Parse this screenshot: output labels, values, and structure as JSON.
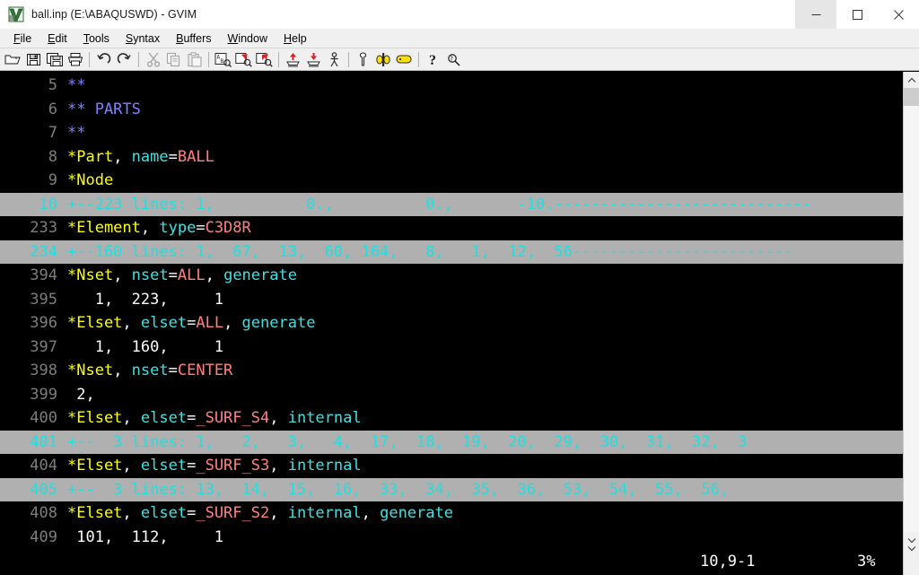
{
  "window": {
    "title": "ball.inp (E:\\ABAQUSWD) - GVIM",
    "app_icon": "gvim-icon",
    "controls": {
      "minimize": "–",
      "maximize": "□",
      "close": "✕"
    }
  },
  "menubar": {
    "items": [
      {
        "label": "File",
        "accel": "F"
      },
      {
        "label": "Edit",
        "accel": "E"
      },
      {
        "label": "Tools",
        "accel": "T"
      },
      {
        "label": "Syntax",
        "accel": "S"
      },
      {
        "label": "Buffers",
        "accel": "B"
      },
      {
        "label": "Window",
        "accel": "W"
      },
      {
        "label": "Help",
        "accel": "H"
      }
    ]
  },
  "toolbar": {
    "buttons": [
      {
        "name": "open-file-icon",
        "tip": "Open file"
      },
      {
        "name": "save-file-icon",
        "tip": "Save current file"
      },
      {
        "name": "save-all-icon",
        "tip": "Save all files"
      },
      {
        "name": "print-icon",
        "tip": "Print"
      },
      {
        "separator": true
      },
      {
        "name": "undo-icon",
        "tip": "Undo"
      },
      {
        "name": "redo-icon",
        "tip": "Redo"
      },
      {
        "separator": true
      },
      {
        "name": "cut-icon",
        "tip": "Cut",
        "disabled": true
      },
      {
        "name": "copy-icon",
        "tip": "Copy",
        "disabled": true
      },
      {
        "name": "paste-icon",
        "tip": "Paste",
        "disabled": true
      },
      {
        "separator": true
      },
      {
        "name": "find-replace-icon",
        "tip": "Find and replace"
      },
      {
        "name": "find-next-icon",
        "tip": "Find next"
      },
      {
        "name": "find-previous-icon",
        "tip": "Find previous"
      },
      {
        "separator": true
      },
      {
        "name": "load-session-icon",
        "tip": "Load session"
      },
      {
        "name": "save-session-icon",
        "tip": "Save session"
      },
      {
        "name": "run-script-icon",
        "tip": "Run a script"
      },
      {
        "separator": true
      },
      {
        "name": "make-icon",
        "tip": "Make current project"
      },
      {
        "name": "shell-icon",
        "tip": "Open a command shell"
      },
      {
        "name": "make-tags-icon",
        "tip": "Make tags"
      },
      {
        "separator": true
      },
      {
        "name": "help-icon",
        "tip": "Help"
      },
      {
        "name": "find-help-icon",
        "tip": "Search help"
      }
    ]
  },
  "editor": {
    "lines": [
      {
        "num": "5",
        "fold": false,
        "tokens": [
          {
            "t": "**",
            "c": "c-comment"
          }
        ]
      },
      {
        "num": "6",
        "fold": false,
        "tokens": [
          {
            "t": "** PARTS",
            "c": "c-comment"
          }
        ]
      },
      {
        "num": "7",
        "fold": false,
        "tokens": [
          {
            "t": "**",
            "c": "c-comment"
          }
        ]
      },
      {
        "num": "8",
        "fold": false,
        "tokens": [
          {
            "t": "*Part",
            "c": "c-keyword"
          },
          {
            "t": ", ",
            "c": "c-punct"
          },
          {
            "t": "name",
            "c": "c-param"
          },
          {
            "t": "=",
            "c": "c-punct"
          },
          {
            "t": "BALL",
            "c": "c-value"
          }
        ]
      },
      {
        "num": "9",
        "fold": false,
        "tokens": [
          {
            "t": "*Node",
            "c": "c-keyword"
          }
        ]
      },
      {
        "num": "10",
        "fold": true,
        "text": "+--223 lines: 1,          0.,          0.,       -10.----------------------------"
      },
      {
        "num": "233",
        "fold": false,
        "tokens": [
          {
            "t": "*Element",
            "c": "c-keyword"
          },
          {
            "t": ", ",
            "c": "c-punct"
          },
          {
            "t": "type",
            "c": "c-param"
          },
          {
            "t": "=",
            "c": "c-punct"
          },
          {
            "t": "C3D8R",
            "c": "c-value"
          }
        ]
      },
      {
        "num": "234",
        "fold": true,
        "text": "+--160 lines: 1,  67,  13,  60, 164,   8,   1,  12,  56------------------------"
      },
      {
        "num": "394",
        "fold": false,
        "tokens": [
          {
            "t": "*Nset",
            "c": "c-keyword"
          },
          {
            "t": ", ",
            "c": "c-punct"
          },
          {
            "t": "nset",
            "c": "c-param"
          },
          {
            "t": "=",
            "c": "c-punct"
          },
          {
            "t": "ALL",
            "c": "c-value"
          },
          {
            "t": ", ",
            "c": "c-punct"
          },
          {
            "t": "generate",
            "c": "c-param"
          }
        ]
      },
      {
        "num": "395",
        "fold": false,
        "tokens": [
          {
            "t": "   1,  223,     1",
            "c": "c-plain"
          }
        ]
      },
      {
        "num": "396",
        "fold": false,
        "tokens": [
          {
            "t": "*Elset",
            "c": "c-keyword"
          },
          {
            "t": ", ",
            "c": "c-punct"
          },
          {
            "t": "elset",
            "c": "c-param"
          },
          {
            "t": "=",
            "c": "c-punct"
          },
          {
            "t": "ALL",
            "c": "c-value"
          },
          {
            "t": ", ",
            "c": "c-punct"
          },
          {
            "t": "generate",
            "c": "c-param"
          }
        ]
      },
      {
        "num": "397",
        "fold": false,
        "tokens": [
          {
            "t": "   1,  160,     1",
            "c": "c-plain"
          }
        ]
      },
      {
        "num": "398",
        "fold": false,
        "tokens": [
          {
            "t": "*Nset",
            "c": "c-keyword"
          },
          {
            "t": ", ",
            "c": "c-punct"
          },
          {
            "t": "nset",
            "c": "c-param"
          },
          {
            "t": "=",
            "c": "c-punct"
          },
          {
            "t": "CENTER",
            "c": "c-value"
          }
        ]
      },
      {
        "num": "399",
        "fold": false,
        "tokens": [
          {
            "t": " 2,",
            "c": "c-plain"
          }
        ]
      },
      {
        "num": "400",
        "fold": false,
        "tokens": [
          {
            "t": "*Elset",
            "c": "c-keyword"
          },
          {
            "t": ", ",
            "c": "c-punct"
          },
          {
            "t": "elset",
            "c": "c-param"
          },
          {
            "t": "=",
            "c": "c-punct"
          },
          {
            "t": "_SURF_S4",
            "c": "c-value"
          },
          {
            "t": ", ",
            "c": "c-punct"
          },
          {
            "t": "internal",
            "c": "c-param"
          }
        ]
      },
      {
        "num": "401",
        "fold": true,
        "text": "+--  3 lines: 1,   2,   3,   4,  17,  18,  19,  20,  29,  30,  31,  32,  3"
      },
      {
        "num": "404",
        "fold": false,
        "tokens": [
          {
            "t": "*Elset",
            "c": "c-keyword"
          },
          {
            "t": ", ",
            "c": "c-punct"
          },
          {
            "t": "elset",
            "c": "c-param"
          },
          {
            "t": "=",
            "c": "c-punct"
          },
          {
            "t": "_SURF_S3",
            "c": "c-value"
          },
          {
            "t": ", ",
            "c": "c-punct"
          },
          {
            "t": "internal",
            "c": "c-param"
          }
        ]
      },
      {
        "num": "405",
        "fold": true,
        "text": "+--  3 lines: 13,  14,  15,  16,  33,  34,  35,  36,  53,  54,  55,  56,"
      },
      {
        "num": "408",
        "fold": false,
        "tokens": [
          {
            "t": "*Elset",
            "c": "c-keyword"
          },
          {
            "t": ", ",
            "c": "c-punct"
          },
          {
            "t": "elset",
            "c": "c-param"
          },
          {
            "t": "=",
            "c": "c-punct"
          },
          {
            "t": "_SURF_S2",
            "c": "c-value"
          },
          {
            "t": ", ",
            "c": "c-punct"
          },
          {
            "t": "internal",
            "c": "c-param"
          },
          {
            "t": ", ",
            "c": "c-punct"
          },
          {
            "t": "generate",
            "c": "c-param"
          }
        ]
      },
      {
        "num": "409",
        "fold": false,
        "tokens": [
          {
            "t": " 101,  112,     1",
            "c": "c-plain"
          }
        ]
      }
    ]
  },
  "statusline": {
    "filename": "",
    "ruler": "10,9-1",
    "percent": "3%"
  },
  "scrollbar": {
    "up_arrow": "scroll-up-icon",
    "down_arrow": "scroll-down-icon"
  },
  "colors": {
    "comment": "#8080ff",
    "keyword": "#ffff00",
    "param": "#40e0e0",
    "value": "#ff8080",
    "plain": "#ffffff",
    "linenum": "#7d7d7d",
    "fold_bg": "#b0b0b0",
    "fold_fg": "#1fe0e0",
    "background": "#000000"
  }
}
